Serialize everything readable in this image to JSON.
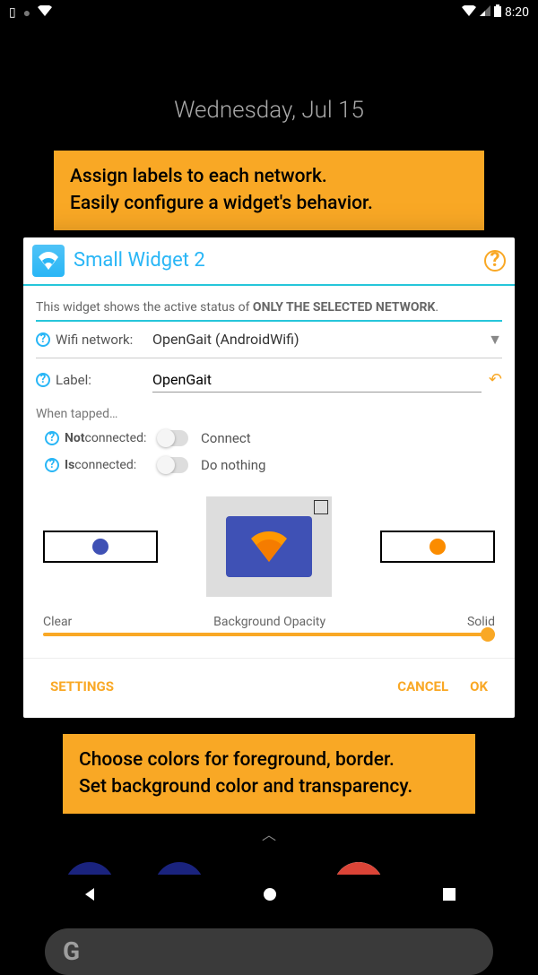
{
  "status": {
    "time": "8:20"
  },
  "date": "Wednesday, Jul 15",
  "callout_top_l1": "Assign labels to each network.",
  "callout_top_l2": "Easily configure a widget's behavior.",
  "callout_bottom_l1": "Choose colors for foreground, border.",
  "callout_bottom_l2": "Set background color and transparency.",
  "dialog": {
    "title": "Small Widget 2",
    "info_prefix": "This widget shows the active status of ",
    "info_bold": "ONLY THE SELECTED NETWORK",
    "wifi_label": "Wifi network:",
    "wifi_value": "OpenGait (AndroidWifi)",
    "label_label": "Label:",
    "label_value": "OpenGait",
    "when_tapped": "When tapped…",
    "not_connected_label": "Not",
    "not_connected_suffix": " connected:",
    "not_connected_value": "Connect",
    "is_connected_label": "Is",
    "is_connected_suffix": " connected:",
    "is_connected_value": "Do nothing",
    "opacity_left": "Clear",
    "opacity_center": "Background Opacity",
    "opacity_right": "Solid",
    "colors": {
      "left": "#3F51B5",
      "right": "#FB8C00"
    },
    "actions": {
      "settings": "SETTINGS",
      "cancel": "CANCEL",
      "ok": "OK"
    }
  },
  "search": "G"
}
